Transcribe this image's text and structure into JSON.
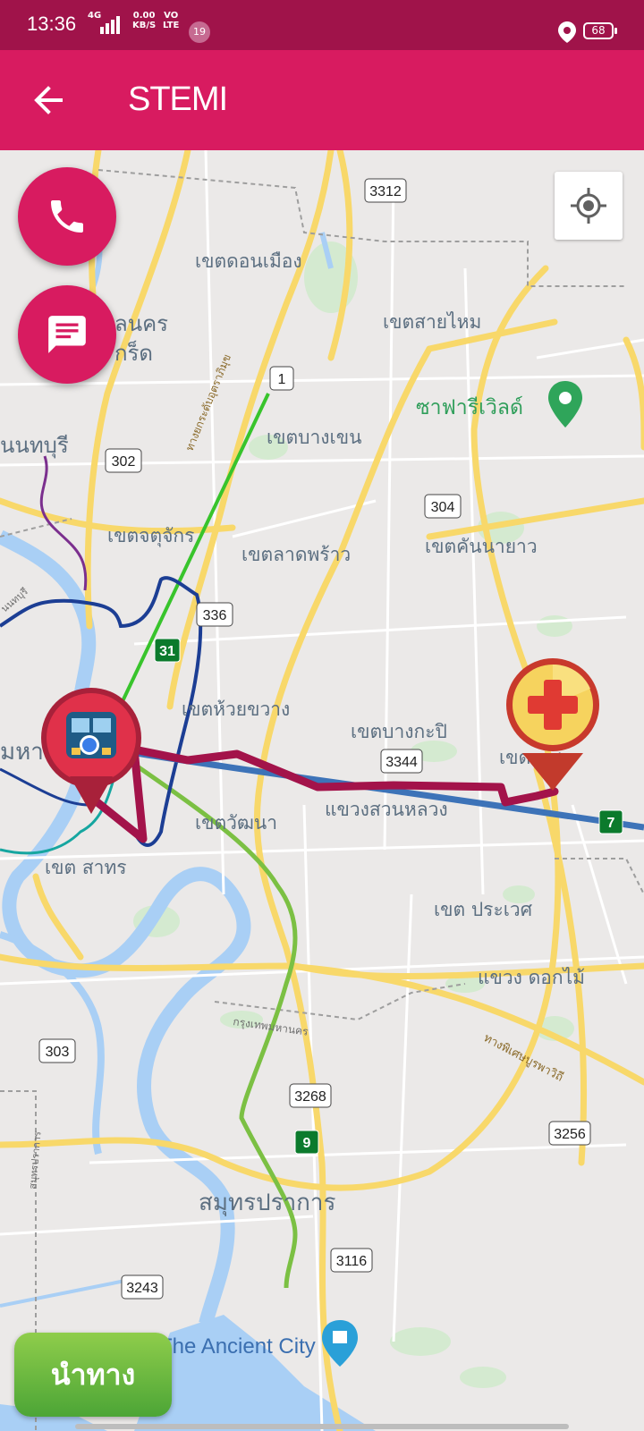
{
  "status_bar": {
    "time": "13:36",
    "network": "4G",
    "speed": "0.00",
    "speed_unit": "KB/S",
    "volte_top": "VO",
    "volte_bottom": "LTE",
    "notification_count": "19",
    "battery": "68"
  },
  "app_bar": {
    "title": "STEMI",
    "back_icon": "arrow-left-icon"
  },
  "actions": {
    "call_icon": "phone-icon",
    "message_icon": "chat-icon",
    "locate_icon": "my-location-icon"
  },
  "navigate_button": {
    "label": "นำทาง"
  },
  "map": {
    "labels": {
      "don_mueang": "เขตดอนเมือง",
      "sai_mai": "เขตสายไหม",
      "lak_si_a": "ลนคร",
      "lak_si_b": "กร็ด",
      "safari_world": "ซาฟารีเวิลด์",
      "bang_khen": "เขตบางเขน",
      "nonthaburi": "นนทบุรี",
      "chatuchak": "เขตจตุจักร",
      "lat_phrao": "เขตลาดพร้าว",
      "khan_na_yao": "เขตคันนายาว",
      "huai_khwang": "เขตห้วยขวาง",
      "bang_kapi": "เขตบางกะปิ",
      "min_buri": "เขต    นสูง",
      "maha": "มหา",
      "suan_luang": "แขวงสวนหลวง",
      "watthana": "เขตวัฒนา",
      "sathon": "เขต สาทร",
      "prawet": "เขต ประเวศ",
      "dok_mai": "แขวง ดอกไม้",
      "bangkok_boundary": "กรุงเทพมหานคร",
      "motorway": "ทางพิเศษบูรพาวิถี",
      "expressway": "ทางยกระดับอุตราภิมุข",
      "samut_prakan": "สมุทรปราการ",
      "samut_road": "สมุทรปราการ",
      "nonthaburi_road": "นนทบุรี",
      "ancient_city": "The Ancient City"
    },
    "shields": {
      "r3312": "3312",
      "r1": "1",
      "r302": "302",
      "r304": "304",
      "r336": "336",
      "r31": "31",
      "r3344": "3344",
      "r7": "7",
      "r303": "303",
      "r3268": "3268",
      "r9": "9",
      "r3256": "3256",
      "r3116": "3116",
      "r3243": "3243"
    },
    "colors": {
      "route": "#a3134a",
      "app_primary": "#d81b60",
      "status_bar": "#a0134a",
      "origin_pin": "#e0314a",
      "hospital_pin": "#d8342e",
      "navigate_green": "#5cb338"
    },
    "markers": {
      "origin_icon": "bus-icon",
      "destination_icon": "hospital-cross-icon"
    }
  }
}
